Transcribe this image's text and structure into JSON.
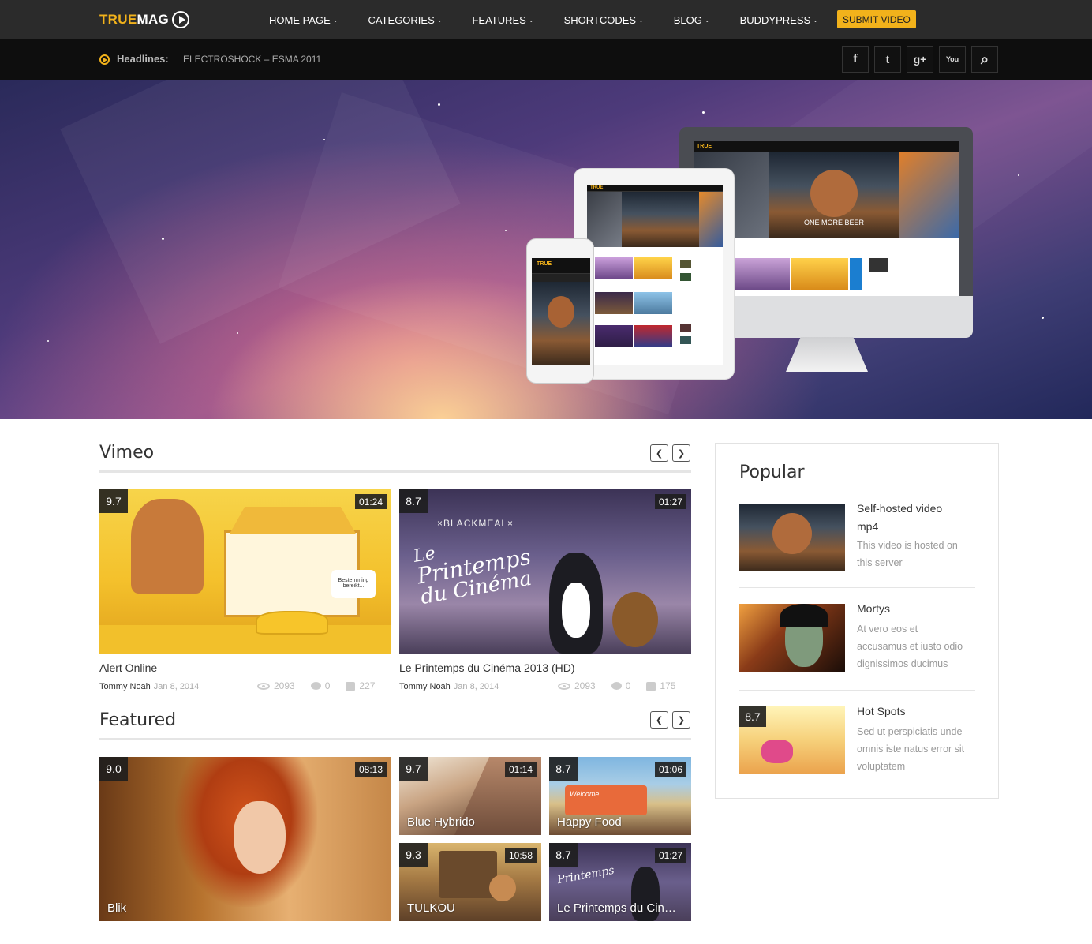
{
  "brand": {
    "logo_part1": "TRUE",
    "logo_part2": "MAG"
  },
  "nav": {
    "items": [
      {
        "label": "HOME PAGE"
      },
      {
        "label": "CATEGORIES"
      },
      {
        "label": "FEATURES"
      },
      {
        "label": "SHORTCODES"
      },
      {
        "label": "BLOG"
      },
      {
        "label": "BUDDYPRESS"
      }
    ],
    "submit_label": "SUBMIT VIDEO"
  },
  "headline": {
    "label": "Headlines:",
    "text": "ELECTROSHOCK – ESMA 2011"
  },
  "social": {
    "facebook": "f",
    "twitter": "t",
    "google": "g+",
    "youtube": "You",
    "search": "⌕"
  },
  "vimeo": {
    "title": "Vimeo",
    "videos": [
      {
        "rating": "9.7",
        "duration": "01:24",
        "title": "Alert Online",
        "author": "Tommy Noah",
        "date": "Jan 8, 2014",
        "views": "2093",
        "comments": "0",
        "likes": "227"
      },
      {
        "rating": "8.7",
        "duration": "01:27",
        "title": "Le Printemps du Cinéma 2013 (HD)",
        "author": "Tommy Noah",
        "date": "Jan 8, 2014",
        "views": "2093",
        "comments": "0",
        "likes": "175"
      }
    ]
  },
  "featured": {
    "title": "Featured",
    "big": {
      "rating": "9.0",
      "duration": "08:13",
      "title": "Blik"
    },
    "small": [
      {
        "rating": "9.7",
        "duration": "01:14",
        "title": "Blue Hybrido"
      },
      {
        "rating": "8.7",
        "duration": "01:06",
        "title": "Happy Food"
      },
      {
        "rating": "9.3",
        "duration": "10:58",
        "title": "TULKOU"
      },
      {
        "rating": "8.7",
        "duration": "01:27",
        "title": "Le Printemps du Cin…"
      }
    ]
  },
  "popular": {
    "title": "Popular",
    "items": [
      {
        "title_line1": "Self-hosted video",
        "title_line2": "mp4",
        "desc_line1": "This video is hosted on",
        "desc_line2": "this server",
        "desc_line3": ""
      },
      {
        "title_line1": "Mortys",
        "title_line2": "",
        "desc_line1": "At vero eos et",
        "desc_line2": "accusamus et iusto odio",
        "desc_line3": "dignissimos ducimus"
      },
      {
        "title_line1": "Hot Spots",
        "title_line2": "",
        "rating": "8.7",
        "desc_line1": "Sed ut perspiciatis unde",
        "desc_line2": "omnis iste natus error sit",
        "desc_line3": "voluptatem"
      }
    ]
  },
  "thumb_texts": {
    "blackmeal": "×BLACKMEAL×",
    "printemps_line1": "Le",
    "printemps_line2": "Printemps",
    "printemps_line3": "du Cinéma",
    "sign": "Bestemming bereikt...",
    "one_more_beer": "ONE MORE BEER",
    "welcome": "Welcome"
  },
  "colors": {
    "accent": "#f2b21b",
    "topbar": "#2b2b2b",
    "headbar": "#0e0e0e"
  }
}
